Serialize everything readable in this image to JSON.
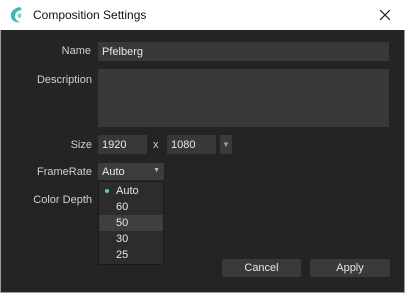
{
  "window": {
    "title": "Composition Settings",
    "icon": "app-logo-icon",
    "close_icon": "close-icon"
  },
  "form": {
    "name_label": "Name",
    "name_value": "Pfelberg",
    "description_label": "Description",
    "description_value": "",
    "size_label": "Size",
    "width_value": "1920",
    "size_separator": "x",
    "height_value": "1080",
    "framerate_label": "FrameRate",
    "framerate_value": "Auto",
    "colordepth_label": "Color Depth"
  },
  "framerate_options": [
    {
      "label": "Auto",
      "selected": true
    },
    {
      "label": "60",
      "selected": false
    },
    {
      "label": "50",
      "selected": false,
      "highlighted": true
    },
    {
      "label": "30",
      "selected": false
    },
    {
      "label": "25",
      "selected": false
    }
  ],
  "buttons": {
    "cancel": "Cancel",
    "apply": "Apply"
  },
  "colors": {
    "accent": "#5cc6d6",
    "background": "#242424",
    "field": "#383838"
  }
}
